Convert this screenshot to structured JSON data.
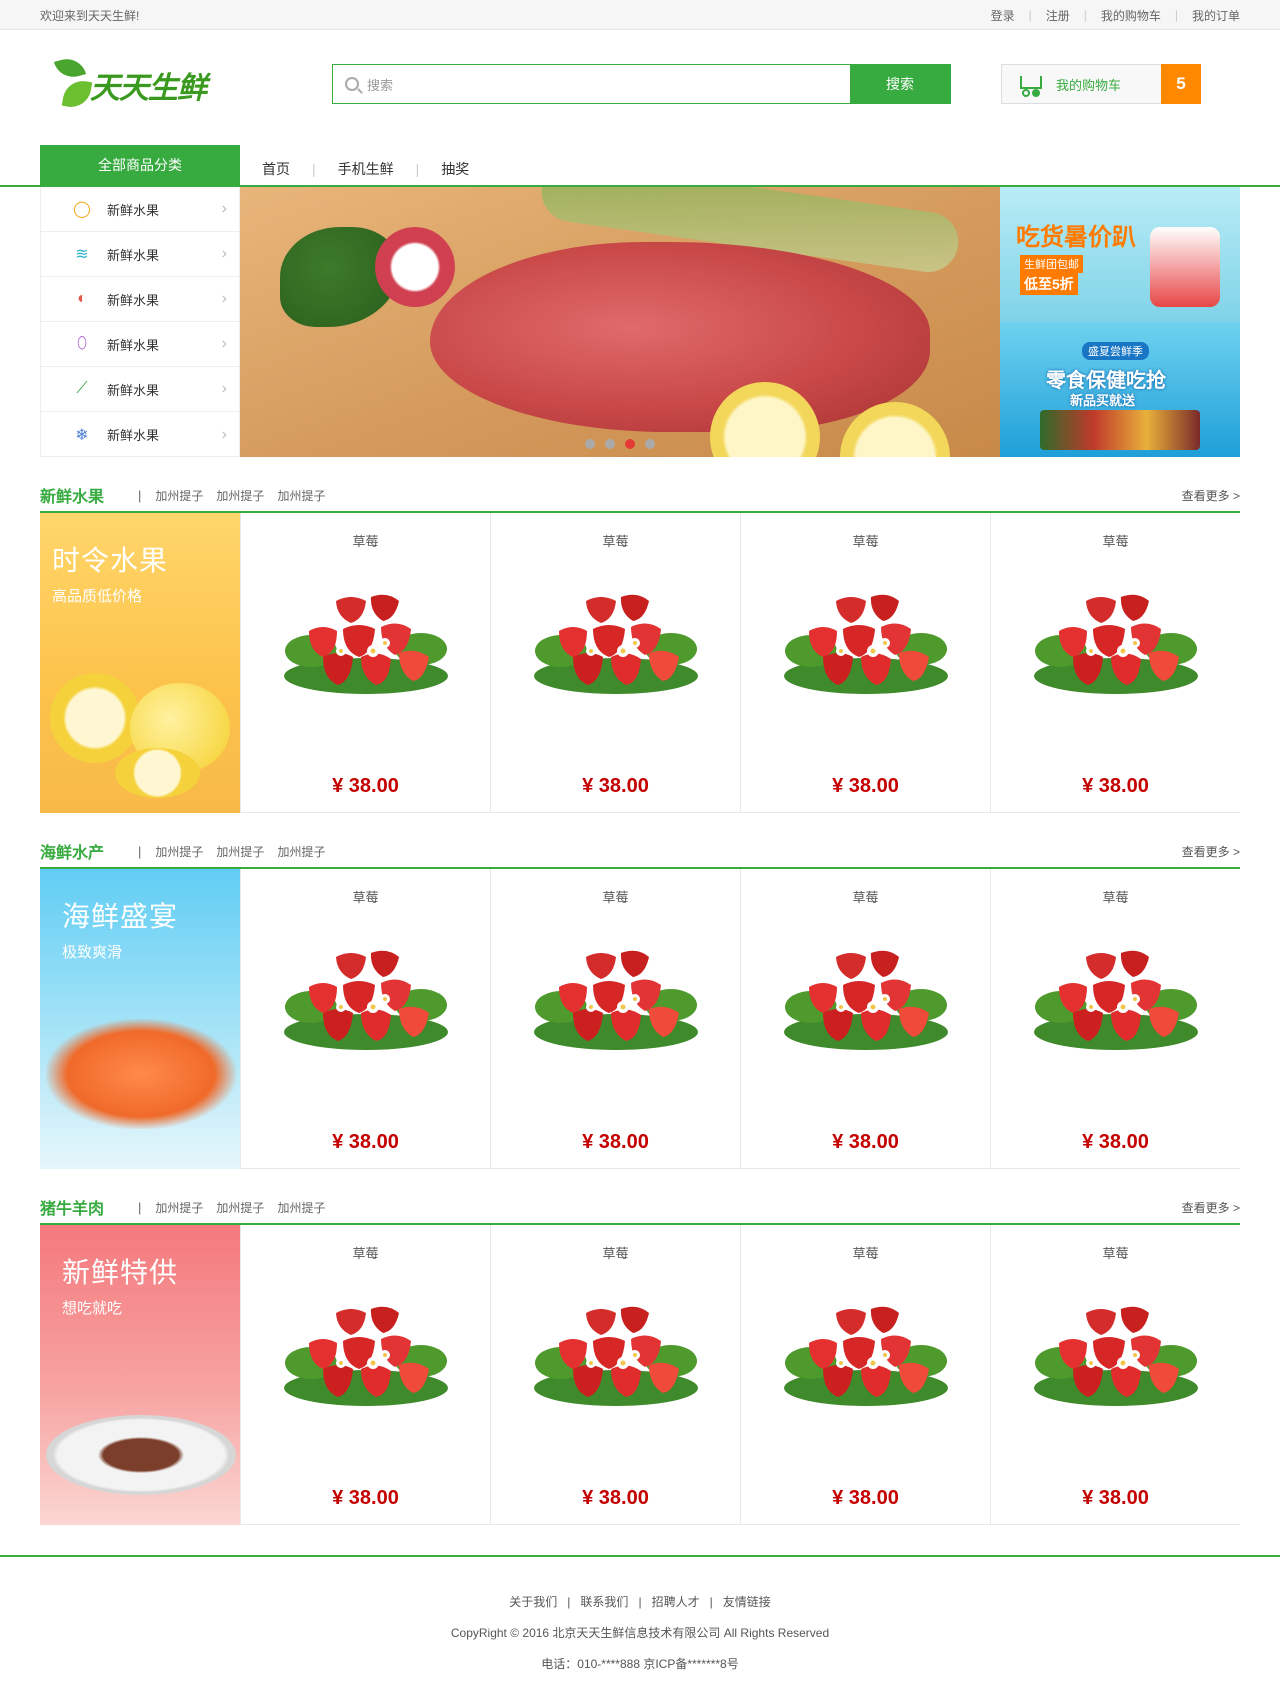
{
  "topbar": {
    "welcome": "欢迎来到天天生鲜!",
    "links": [
      "登录",
      "注册",
      "我的购物车",
      "我的订单"
    ]
  },
  "header": {
    "logo_text": "天天生鲜",
    "search_placeholder": "搜索",
    "search_button": "搜索",
    "cart_label": "我的购物车",
    "cart_count": "5"
  },
  "nav": {
    "all_categories": "全部商品分类",
    "items": [
      "首页",
      "手机生鲜",
      "抽奖"
    ]
  },
  "categories": [
    {
      "label": "新鲜水果",
      "icon": "fruit-icon"
    },
    {
      "label": "新鲜水果",
      "icon": "seafood-icon"
    },
    {
      "label": "新鲜水果",
      "icon": "meat-icon"
    },
    {
      "label": "新鲜水果",
      "icon": "egg-icon"
    },
    {
      "label": "新鲜水果",
      "icon": "vegetable-icon"
    },
    {
      "label": "新鲜水果",
      "icon": "frozen-icon"
    }
  ],
  "carousel": {
    "slide_count": 4,
    "active_index": 2
  },
  "ads": {
    "ad1": {
      "title": "吃货暑价趴",
      "tag1": "生鲜团包邮",
      "tag2": "低至5折"
    },
    "ad2": {
      "title": "零食保健吃抢",
      "sub": "盛夏尝鲜季",
      "tag": "新品买就送"
    }
  },
  "sections": [
    {
      "title": "新鲜水果",
      "tags": [
        "加州提子",
        "加州提子",
        "加州提子"
      ],
      "more": "查看更多 >",
      "promo_title": "时令水果",
      "promo_sub": "高品质低价格",
      "products": [
        {
          "name": "草莓",
          "price": "¥ 38.00"
        },
        {
          "name": "草莓",
          "price": "¥ 38.00"
        },
        {
          "name": "草莓",
          "price": "¥ 38.00"
        },
        {
          "name": "草莓",
          "price": "¥ 38.00"
        }
      ]
    },
    {
      "title": "海鲜水产",
      "tags": [
        "加州提子",
        "加州提子",
        "加州提子"
      ],
      "more": "查看更多 >",
      "promo_title": "海鲜盛宴",
      "promo_sub": "极致爽滑",
      "products": [
        {
          "name": "草莓",
          "price": "¥ 38.00"
        },
        {
          "name": "草莓",
          "price": "¥ 38.00"
        },
        {
          "name": "草莓",
          "price": "¥ 38.00"
        },
        {
          "name": "草莓",
          "price": "¥ 38.00"
        }
      ]
    },
    {
      "title": "猪牛羊肉",
      "tags": [
        "加州提子",
        "加州提子",
        "加州提子"
      ],
      "more": "查看更多 >",
      "promo_title": "新鲜特供",
      "promo_sub": "想吃就吃",
      "products": [
        {
          "name": "草莓",
          "price": "¥ 38.00"
        },
        {
          "name": "草莓",
          "price": "¥ 38.00"
        },
        {
          "name": "草莓",
          "price": "¥ 38.00"
        },
        {
          "name": "草莓",
          "price": "¥ 38.00"
        }
      ]
    }
  ],
  "footer": {
    "links": [
      "关于我们",
      "联系我们",
      "招聘人才",
      "友情链接"
    ],
    "copyright": "CopyRight © 2016 北京天天生鲜信息技术有限公司 All Rights Reserved",
    "contact": "电话：010-****888 京ICP备*******8号"
  },
  "colors": {
    "brand_green": "#37ab40",
    "cart_orange": "#ff8800",
    "price_red": "#c40000"
  }
}
